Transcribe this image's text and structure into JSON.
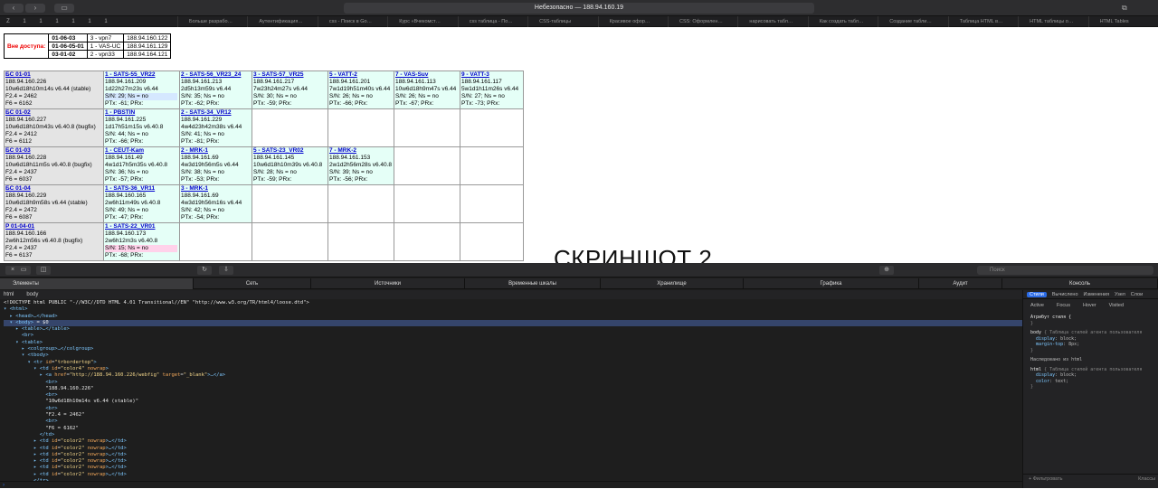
{
  "browser": {
    "url": "Небезопасно — 188.94.160.19",
    "pins": [
      "Z",
      "1",
      "1",
      "1",
      "1",
      "1",
      "1"
    ],
    "tabs": [
      "Больше разрабо…",
      "Аутентификация…",
      "css - Поиск в Go…",
      "Курс «Вчекомст…",
      "css таблица - По…",
      "CSS-таблицы",
      "Красивое офор…",
      "CSS: Оформлен…",
      "нарисовать табл…",
      "Как создать табл…",
      "Создание табли…",
      "Таблица HTML в…",
      "HTML таблицы о…",
      "HTML Tables"
    ]
  },
  "offline": {
    "label": "Вне доступа:",
    "rows": [
      [
        "01-06-03",
        "3 - vpn7",
        "188.94.160.122"
      ],
      [
        "01-06-05-01",
        "1 - VAS-UC",
        "188.94.161.129"
      ],
      [
        "03-01-02",
        "2 - vpn33",
        "188.94.164.121"
      ]
    ]
  },
  "grid": {
    "rows": [
      {
        "hdr": {
          "title": "БС 01-01",
          "lines": [
            "188.94.160.226",
            "10w6d18h10m14s v6.44 (stable)",
            "F2.4 = 2462",
            "F6 = 6162"
          ]
        },
        "cells": [
          {
            "title": "1 - SATS-55_VR22",
            "lines": [
              "188.94.161.209",
              "1d22h27m23s v6.44",
              "S/N: 29; Ns = no",
              "PTx: -61; PRx:"
            ]
          },
          {
            "title": "2 - SATS-56_VR23_24",
            "lines": [
              "188.94.161.213",
              "2d5h13m59s v6.44",
              "S/N: 35; Ns = no",
              "PTx: -62; PRx:"
            ]
          },
          {
            "title": "3 - SATS-57_VR25",
            "lines": [
              "188.94.161.217",
              "7w23h24m27s v6.44",
              "S/N: 30; Ns = no",
              "PTx: -59; PRx:"
            ]
          },
          {
            "title": "5 - VATT-2",
            "lines": [
              "188.94.161.201",
              "7w1d19h51m40s v6.44",
              "S/N: 26; Ns = no",
              "PTx: -66; PRx:"
            ]
          },
          {
            "title": "7 - VAS-Suv",
            "lines": [
              "188.94.161.113",
              "10w6d18h9m47s v6.44",
              "S/N: 26; Ns = no",
              "PTx: -67; PRx:"
            ]
          },
          {
            "title": "9 - VATT-3",
            "lines": [
              "188.94.161.117",
              "5w1d1h11m26s v6.44",
              "S/N: 27; Ns = no",
              "PTx: -73; PRx:"
            ]
          }
        ]
      },
      {
        "hdr": {
          "title": "БС 01-02",
          "lines": [
            "188.94.160.227",
            "10w6d18h10m43s v6.40.8 (bugfix)",
            "F2.4 = 2412",
            "F6 = 6112"
          ]
        },
        "cells": [
          {
            "title": "1 - PBSTIN",
            "lines": [
              "188.94.161.225",
              "1d17h51m15s v6.40.8",
              "S/N: 44; Ns = no",
              "PTx: -66; PRx:"
            ]
          },
          {
            "title": "2 - SATS-34_VR12",
            "lines": [
              "188.94.161.229",
              "4w4d23h42m38s v6.44",
              "S/N: 41; Ns = no",
              "PTx: -81; PRx:"
            ]
          }
        ]
      },
      {
        "hdr": {
          "title": "БС 01-03",
          "lines": [
            "188.94.160.228",
            "10w6d18h11m5s v6.40.8 (bugfix)",
            "F2.4 = 2437",
            "F6 = 6037"
          ]
        },
        "cells": [
          {
            "title": "1 - CEUT-Kam",
            "lines": [
              "188.94.161.49",
              "4w1d17h5m35s v6.40.8",
              "S/N: 36; Ns = no",
              "PTx: -57; PRx:"
            ]
          },
          {
            "title": "2 - MRK-1",
            "lines": [
              "188.94.161.69",
              "4w3d19h56m5s v6.44",
              "S/N: 38; Ns = no",
              "PTx: -53; PRx:"
            ]
          },
          {
            "title": "5 - SATS-23_VR02",
            "lines": [
              "188.94.161.145",
              "10w6d18h10m39s v6.40.8",
              "S/N: 28; Ns = no",
              "PTx: -59; PRx:"
            ]
          },
          {
            "title": "7 - MRK-2",
            "lines": [
              "188.94.161.153",
              "2w1d2h56m28s v6.40.8",
              "S/N: 39; Ns = no",
              "PTx: -56; PRx:"
            ]
          }
        ]
      },
      {
        "hdr": {
          "title": "БС 01-04",
          "lines": [
            "188.94.160.229",
            "10w6d18h9m58s v6.44 (stable)",
            "F2.4 = 2472",
            "F6 = 6087"
          ]
        },
        "cells": [
          {
            "title": "1 - SATS-36_VR11",
            "lines": [
              "188.94.160.165",
              "2w6h11m49s v6.40.8",
              "S/N: 49; Ns = no",
              "PTx: -47; PRx:"
            ]
          },
          {
            "title": "3 - MRK-1",
            "lines": [
              "188.94.161.69",
              "4w3d19h56m16s v6.44",
              "S/N: 42; Ns = no",
              "PTx: -54; PRx:"
            ]
          }
        ]
      },
      {
        "hdr": {
          "title": "P 01-04-01",
          "lines": [
            "188.94.160.166",
            "2w6h12m56s v6.40.8 (bugfix)",
            "F2.4 = 2437",
            "F6 = 6137"
          ]
        },
        "cells": [
          {
            "title": "1 - SATS-22_VR01",
            "lines": [
              "188.94.160.173",
              "2w6h12m3s v6.40.8",
              "S/N: 15; Ns = no",
              "PTx: -68; PRx:"
            ]
          }
        ]
      }
    ]
  },
  "caption": "СКРИНШОТ 2",
  "inspector": {
    "search_placeholder": "Поиск",
    "tabs": [
      "Элементы",
      "Сеть",
      "Источники",
      "Временные шкалы",
      "Хранилище",
      "Графика",
      "Аудит",
      "Консоль"
    ],
    "crumbs": [
      "html",
      "body"
    ],
    "side_tabs": [
      "Стили",
      "Вычислено",
      "Изменения",
      "Узел",
      "Слои"
    ],
    "pseudo": [
      "Active",
      "Focus",
      "Hover",
      "Visited"
    ],
    "style_attr": "Атрибут стиля  {",
    "ua_label": "Таблица стилей агента пользователя",
    "inherited": "Наследовано из html",
    "filter": "Фильтровать",
    "classes": "Классы"
  }
}
